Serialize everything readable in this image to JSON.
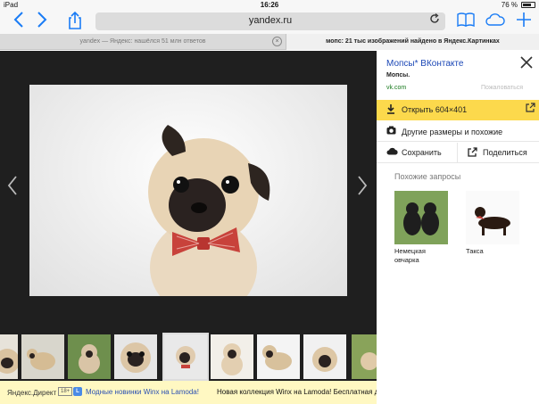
{
  "status": {
    "device": "iPad",
    "time": "16:26",
    "battery": "76 %",
    "battery_level": 0.76
  },
  "toolbar": {
    "url": "yandex.ru",
    "icons": [
      "back-icon",
      "forward-icon",
      "share-icon",
      "reload-icon",
      "bookmarks-icon",
      "cloud-tabs-icon",
      "new-tab-icon"
    ]
  },
  "tabs": [
    {
      "title": "yandex — Яндекс: нашёлся 51 млн ответов"
    },
    {
      "title": "мопс: 21 тыс изображений найдено в Яндекс.Картинках"
    }
  ],
  "panel": {
    "title": "Мопсы* ВКонтакте",
    "subtitle": "Мопсы.",
    "domain": "vk.com",
    "complain": "Пожаловаться",
    "open_label": "Открыть 604×401",
    "sizes_label": "Другие размеры и похожие",
    "save_label": "Сохранить",
    "share_label": "Поделиться",
    "similar_heading": "Похожие запросы",
    "similar": [
      {
        "caption": "Немецкая овчарка"
      },
      {
        "caption": "Такса"
      }
    ]
  },
  "ad": {
    "direct": "Яндекс.Директ",
    "age": "18+",
    "title": "Модные новинки Winx на Lamoda!",
    "text": "Новая коллекция Winx на Lamoda! Бесплатная дос..."
  }
}
